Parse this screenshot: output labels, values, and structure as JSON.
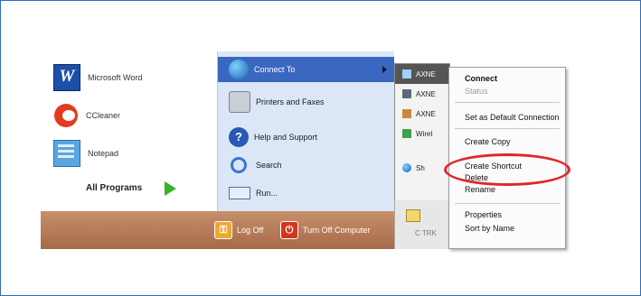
{
  "start_menu": {
    "pinned": [
      {
        "label": "Microsoft Word",
        "icon": "word-icon"
      },
      {
        "label": "CCleaner",
        "icon": "ccleaner-icon"
      },
      {
        "label": "Notepad",
        "icon": "notepad-icon"
      }
    ],
    "all_programs": "All Programs",
    "right_items": [
      {
        "label": "Connect To",
        "icon": "network-globe-icon"
      },
      {
        "label": "Printers and Faxes",
        "icon": "printer-icon"
      },
      {
        "label": "Help and Support",
        "icon": "help-icon"
      },
      {
        "label": "Search",
        "icon": "search-icon"
      },
      {
        "label": "Run...",
        "icon": "run-icon"
      }
    ],
    "log_off": "Log Off",
    "turn_off": "Turn Off Computer"
  },
  "connect_submenu": {
    "items": [
      "AXNE",
      "AXNE",
      "AXNE",
      "Wirel",
      "Sh"
    ],
    "strip_label": "C TRK"
  },
  "context_menu": {
    "items": [
      {
        "label": "Connect",
        "style": "bold"
      },
      {
        "label": "Status",
        "style": "disabled"
      },
      {
        "label": "Set as Default Connection",
        "style": "normal"
      },
      {
        "label": "Create Copy",
        "style": "normal"
      },
      {
        "label": "Create Shortcut",
        "style": "normal"
      },
      {
        "label": "Delete",
        "style": "normal"
      },
      {
        "label": "Rename",
        "style": "normal"
      },
      {
        "label": "Properties",
        "style": "normal"
      },
      {
        "label": "Sort by Name",
        "style": "normal"
      }
    ]
  },
  "colors": {
    "highlight": "#3a67c0",
    "frame_border": "#2f6db8",
    "annotation": "#e0262a"
  }
}
